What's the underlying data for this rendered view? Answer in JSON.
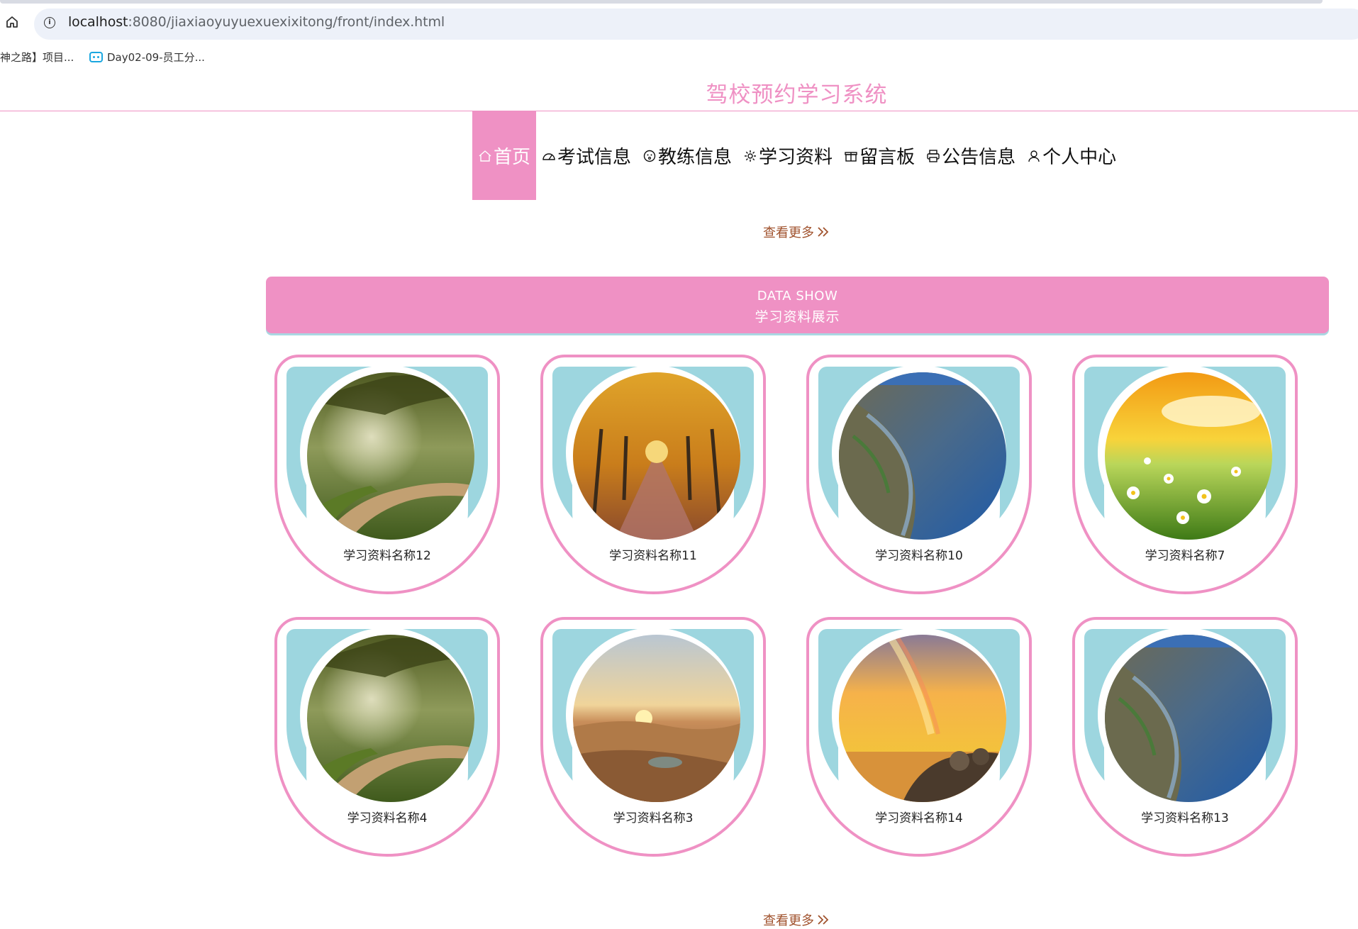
{
  "browser": {
    "url_host": "localhost",
    "url_rest": ":8080/jiaxiaoyuyuexuexixitong/front/index.html",
    "bookmarks": [
      "神之路】项目...",
      "Day02-09-员工分..."
    ]
  },
  "header": {
    "site_title": "驾校预约学习系统",
    "nav": [
      {
        "label": "首页",
        "icon": "home-icon",
        "active": true
      },
      {
        "label": "考试信息",
        "icon": "gauge-icon"
      },
      {
        "label": "教练信息",
        "icon": "face-icon"
      },
      {
        "label": "学习资料",
        "icon": "gear-icon"
      },
      {
        "label": "留言板",
        "icon": "gift-icon"
      },
      {
        "label": "公告信息",
        "icon": "printer-icon"
      },
      {
        "label": "个人中心",
        "icon": "user-icon"
      }
    ]
  },
  "more_label": "查看更多",
  "section": {
    "title_en": "DATA SHOW",
    "title_cn": "学习资料展示"
  },
  "cards": [
    {
      "name": "学习资料名称12",
      "image": "forest-path"
    },
    {
      "name": "学习资料名称11",
      "image": "autumn-avenue"
    },
    {
      "name": "学习资料名称10",
      "image": "tidal-shore"
    },
    {
      "name": "学习资料名称7",
      "image": "daisy-meadow"
    },
    {
      "name": "学习资料名称4",
      "image": "forest-path"
    },
    {
      "name": "学习资料名称3",
      "image": "desert-sunset"
    },
    {
      "name": "学习资料名称14",
      "image": "rainbow-sea"
    },
    {
      "name": "学习资料名称13",
      "image": "tidal-shore"
    }
  ],
  "colors": {
    "accent": "#ef91c4",
    "teal": "#9dd6df",
    "more_link": "#a0522d"
  }
}
